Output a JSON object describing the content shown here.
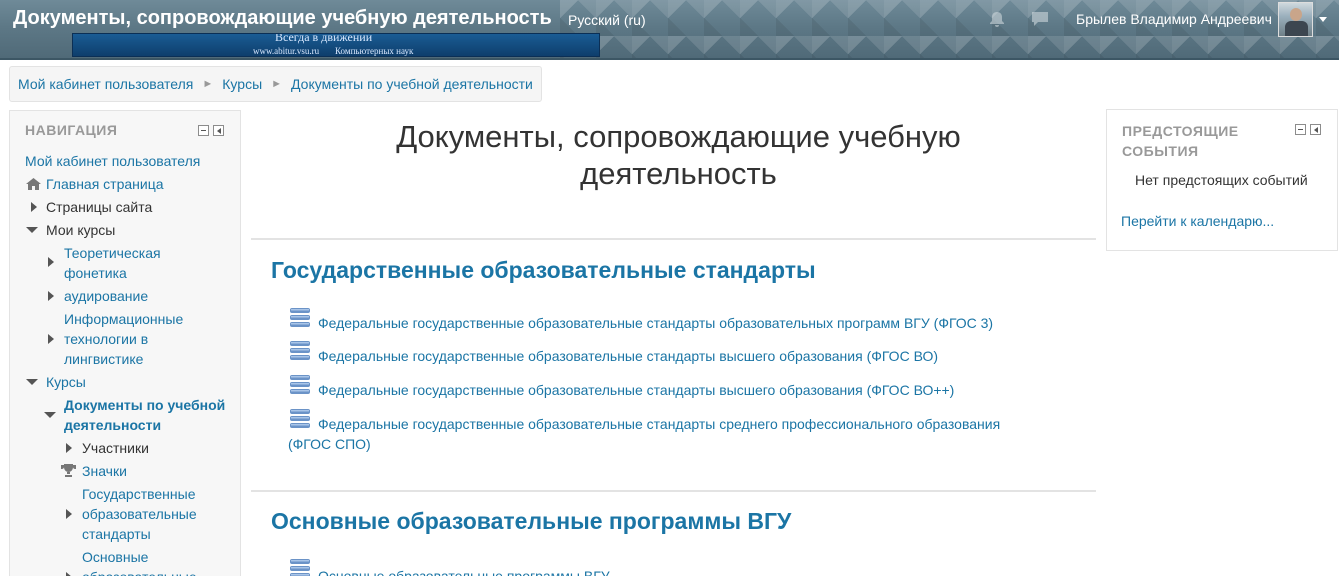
{
  "header": {
    "site_title": "Документы, сопровождающие учебную деятельность",
    "language": "Русский (ru)",
    "user_name": "Брылев Владимир Андреевич",
    "banner_text_1": "Всегда в движении",
    "banner_text_2": "www.abitur.vsu.ru",
    "banner_text_3": "Компьютерных наук"
  },
  "breadcrumb": {
    "items": [
      "Мой кабинет пользователя",
      "Курсы",
      "Документы по учебной деятельности"
    ],
    "separator": "►"
  },
  "navigation": {
    "title": "НАВИГАЦИЯ",
    "items": [
      "Мой кабинет пользователя",
      "Главная страница",
      "Страницы сайта",
      "Мои курсы",
      "Теоретическая",
      "фонетика",
      "аудирование",
      "Информационные",
      "технологии в",
      "лингвистике",
      "Курсы",
      "Документы по учебной",
      "деятельности",
      "Участники",
      "Значки",
      "Государственные",
      "образовательные",
      "стандарты",
      "Основные",
      "образовательные"
    ]
  },
  "main": {
    "course_title_line1": "Документы, сопровождающие учебную",
    "course_title_line2": "деятельность",
    "sections": [
      {
        "title": "Государственные образовательные стандарты",
        "activities": [
          "Федеральные государственные образовательные стандарты образовательных программ ВГУ (ФГОС 3)",
          "Федеральные государственные образовательные стандарты высшего образования (ФГОС ВО)",
          "Федеральные государственные образовательные стандарты высшего образования (ФГОС ВО++)",
          "Федеральные государственные образовательные стандарты среднего профессионального образования",
          "(ФГОС СПО)"
        ]
      },
      {
        "title": "Основные образовательные программы ВГУ",
        "activities": [
          "Основные образовательные программы ВГУ"
        ]
      }
    ]
  },
  "events": {
    "title_line1": "ПРЕДСТОЯЩИЕ",
    "title_line2": "СОБЫТИЯ",
    "empty": "Нет предстоящих событий",
    "calendar_link": "Перейти к календарю..."
  },
  "colors": {
    "link": "#1b75a5",
    "header": "#5d7886",
    "block_title": "#999999"
  }
}
